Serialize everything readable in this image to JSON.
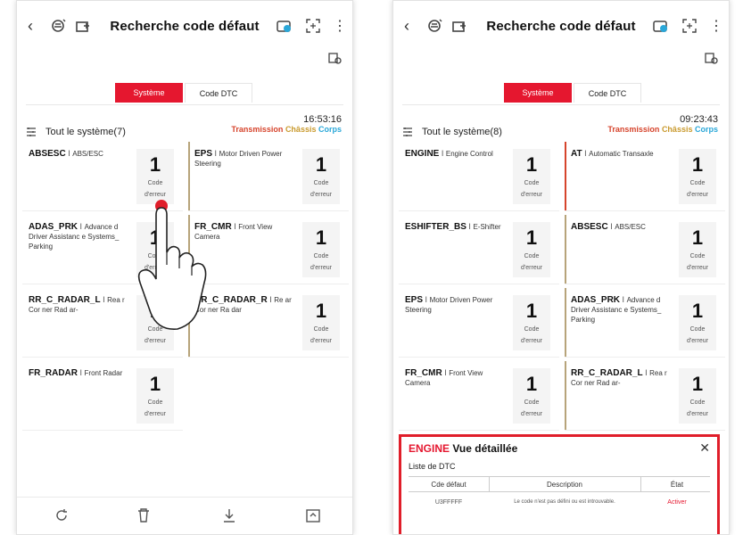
{
  "common": {
    "title": "Recherche code défaut",
    "tab_system": "Système",
    "tab_dtc": "Code DTC",
    "categories": {
      "transmission": "Transmission",
      "chassis": "Châssis",
      "corps": "Corps"
    },
    "error_label_1": "Code",
    "error_label_2": "d'erreur",
    "icons": [
      "back-arrow-icon",
      "car-scan-icon",
      "car-plus-icon",
      "camera-car-icon",
      "screenshot-icon",
      "more-vertical-icon",
      "car-settings-icon"
    ],
    "colors": {
      "accent": "#e5172f",
      "transmission": "#d6442c",
      "chassis": "#c99a2e",
      "corps": "#2aa7d8"
    }
  },
  "left": {
    "time": "16:53:16",
    "system_label": "Tout le système(7)",
    "cards": [
      {
        "code": "ABSESC",
        "desc": "ABS/ESC",
        "count": "1",
        "stripe": "none"
      },
      {
        "code": "EPS",
        "desc": "Motor Driven Power Steering",
        "count": "1",
        "stripe": "#b7a47a"
      },
      {
        "code": "ADAS_PRK",
        "desc": "Advance d Driver Assistanc e Systems_ Parking",
        "count": "1",
        "stripe": "none"
      },
      {
        "code": "FR_CMR",
        "desc": "Front View Camera",
        "count": "1",
        "stripe": "#b7a47a"
      },
      {
        "code": "RR_C_RADAR_L",
        "desc": "Rea r Cor ner Rad ar-",
        "count": "1",
        "stripe": "none"
      },
      {
        "code": "RR_C_RADAR_R",
        "desc": "Re ar Cor ner Ra dar",
        "count": "1",
        "stripe": "#b7a47a"
      },
      {
        "code": "FR_RADAR",
        "desc": "Front Radar",
        "count": "1",
        "stripe": "none"
      }
    ],
    "bottom_icons": [
      "refresh-icon",
      "trash-icon",
      "download-icon",
      "export-icon"
    ]
  },
  "right": {
    "time": "09:23:43",
    "system_label": "Tout le système(8)",
    "cards": [
      {
        "code": "ENGINE",
        "desc": "Engine Control",
        "count": "1",
        "stripe": "none"
      },
      {
        "code": "AT",
        "desc": "Automatic Transaxle",
        "count": "1",
        "stripe": "#d6442c"
      },
      {
        "code": "ESHIFTER_BS",
        "desc": "E-Shifter",
        "count": "1",
        "stripe": "none"
      },
      {
        "code": "ABSESC",
        "desc": "ABS/ESC",
        "count": "1",
        "stripe": "#b7a47a"
      },
      {
        "code": "EPS",
        "desc": "Motor Driven Power Steering",
        "count": "1",
        "stripe": "none"
      },
      {
        "code": "ADAS_PRK",
        "desc": "Advance d Driver Assistanc e Systems_ Parking",
        "count": "1",
        "stripe": "#b7a47a"
      },
      {
        "code": "FR_CMR",
        "desc": "Front View Camera",
        "count": "1",
        "stripe": "none"
      },
      {
        "code": "RR_C_RADAR_L",
        "desc": "Rea r Cor ner Rad ar-",
        "count": "1",
        "stripe": "#b7a47a"
      }
    ],
    "detail": {
      "module": "ENGINE",
      "title": "Vue détaillée",
      "close": "✕",
      "list_title": "Liste de DTC",
      "headers": {
        "code": "Cde défaut",
        "description": "Description",
        "state": "État"
      },
      "row": {
        "code": "U3FFFFF",
        "description": "Le code n'est pas défini ou est introuvable.",
        "state": "Activer"
      }
    }
  }
}
